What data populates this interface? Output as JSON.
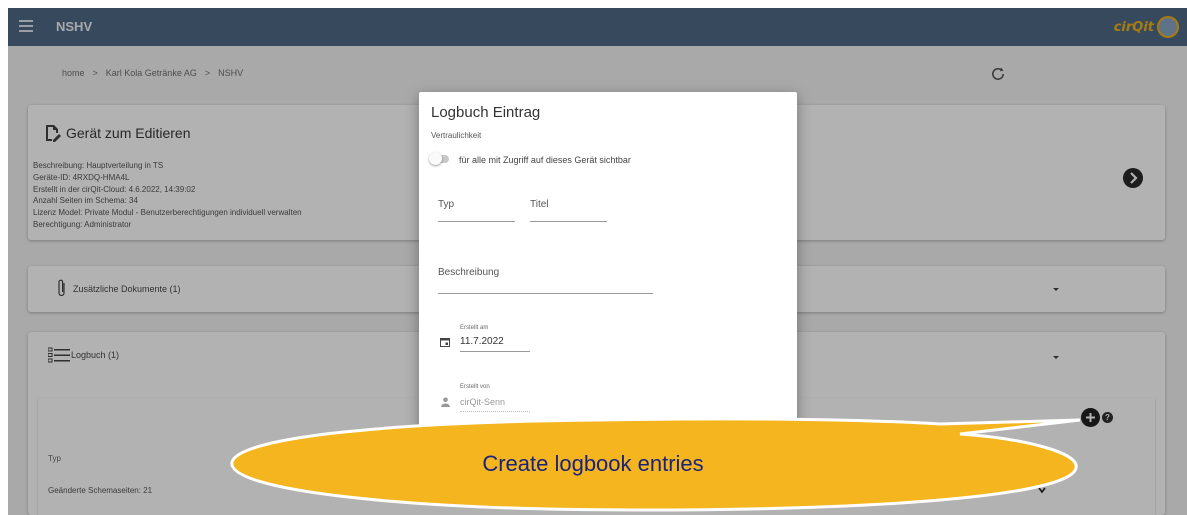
{
  "appbar": {
    "title": "NSHV",
    "logo_text": "cirQit"
  },
  "breadcrumb": {
    "items": [
      "home",
      "Karl Kola Getränke AG",
      "NSHV"
    ],
    "separator": ">"
  },
  "device_card": {
    "title": "Gerät zum Editieren",
    "info": [
      "Beschreibung: Hauptverteilung in TS",
      "Geräte-ID: 4RXDQ-HMA4L",
      "Erstellt in der cirQit-Cloud: 4.6.2022, 14:39:02",
      "Anzahl Seiten im Schema: 34",
      "Lizenz Model: Private Modul - Benutzerberechtigungen individuell verwalten",
      "Berechtigung: Administrator"
    ]
  },
  "documents_card": {
    "label": "Zusätzliche Dokumente (1)"
  },
  "logbook_card": {
    "label": "Logbuch (1)",
    "table_header": "Typ",
    "row": "Geänderte Schemaseiten: 21",
    "help": "?"
  },
  "dialog": {
    "title": "Logbuch Eintrag",
    "confidentiality_label": "Vertraulichkeit",
    "toggle_label": "für alle mit Zugriff auf dieses Gerät sichtbar",
    "typ_placeholder": "Typ",
    "titel_placeholder": "Titel",
    "beschreibung_placeholder": "Beschreibung",
    "created_on_label": "Erstellt am",
    "created_on_value": "11.7.2022",
    "created_by_label": "Erstellt von",
    "created_by_value": "cirQit-Senn"
  },
  "callout": {
    "text": "Create logbook entries"
  },
  "colors": {
    "appbar": "#4f6a86",
    "callout_fill": "#f5b51e",
    "callout_text": "#1a237e",
    "logo": "#f2b21b"
  }
}
